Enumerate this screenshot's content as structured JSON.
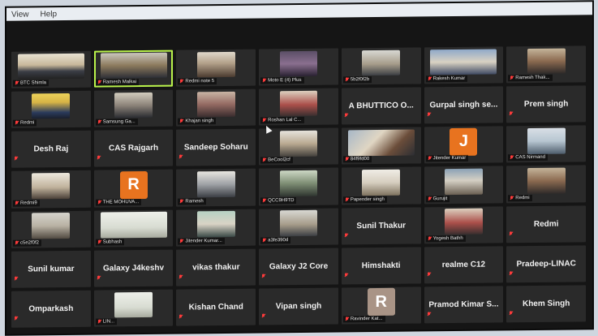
{
  "menubar": {
    "view": "View",
    "help": "Help"
  },
  "tiles": [
    {
      "type": "video",
      "label": "BTC Shimla",
      "scene": "sc1",
      "wide": true
    },
    {
      "type": "video",
      "label": "Ramesh Malkai",
      "scene": "sc2",
      "wide": true,
      "active": true
    },
    {
      "type": "video",
      "label": "Redmi note 5",
      "scene": "sc4"
    },
    {
      "type": "video",
      "label": "Moto E (4) Plus",
      "scene": "sc3"
    },
    {
      "type": "video",
      "label": "5b2f0f2b",
      "scene": "sc7"
    },
    {
      "type": "video",
      "label": "Rakesh Kumar",
      "scene": "sc5",
      "wide": true
    },
    {
      "type": "video",
      "label": "Ramesh Thak...",
      "scene": "sc8"
    },
    {
      "type": "video",
      "label": "Redmi",
      "scene": "sc6"
    },
    {
      "type": "video",
      "label": "Samsung Ga...",
      "scene": "sc10"
    },
    {
      "type": "video",
      "label": "Khajan singh",
      "scene": "sc9"
    },
    {
      "type": "video",
      "label": "Roshan Lal C...",
      "scene": "sc20"
    },
    {
      "type": "name",
      "name": "A BHUTTICO O..."
    },
    {
      "type": "name",
      "name": "Gurpal singh se..."
    },
    {
      "type": "name",
      "name": "Prem singh"
    },
    {
      "type": "name",
      "name": "Desh Raj"
    },
    {
      "type": "name",
      "name": "CAS Rajgarh"
    },
    {
      "type": "name",
      "name": "Sandeep Soharu"
    },
    {
      "type": "video",
      "label": "BeCool2cf",
      "scene": "sc12"
    },
    {
      "type": "video",
      "label": "84f9fd00",
      "scene": "sc11",
      "wide": true
    },
    {
      "type": "avatar",
      "letter": "J",
      "label": "Jitender Kumar",
      "color": "#e8731f"
    },
    {
      "type": "video",
      "label": "CAS Nirmand",
      "scene": "sc13"
    },
    {
      "type": "video",
      "label": "Redmi9",
      "scene": "sc16"
    },
    {
      "type": "avatar",
      "letter": "R",
      "label": "THE MOHUVA...",
      "color": "#e8731f"
    },
    {
      "type": "video",
      "label": "Ramesh",
      "scene": "sc15"
    },
    {
      "type": "video",
      "label": "QCC9H9TD",
      "scene": "sc14"
    },
    {
      "type": "video",
      "label": "Papender singh",
      "scene": "sc18"
    },
    {
      "type": "video",
      "label": "Gurujit",
      "scene": "sc17"
    },
    {
      "type": "video",
      "label": "Redmi",
      "scene": "sc8"
    },
    {
      "type": "video",
      "label": "c5e2f0f2",
      "scene": "sc21"
    },
    {
      "type": "video",
      "label": "Subhash",
      "scene": "sc22",
      "wide": true
    },
    {
      "type": "video",
      "label": "Jitender Kumar...",
      "scene": "sc19"
    },
    {
      "type": "video",
      "label": "a3fe390d",
      "scene": "sc7"
    },
    {
      "type": "name",
      "name": "Sunil Thakur"
    },
    {
      "type": "video",
      "label": "Yogesh Bathh",
      "scene": "sc20"
    },
    {
      "type": "name",
      "name": "Redmi"
    },
    {
      "type": "name",
      "name": "Sunil kumar"
    },
    {
      "type": "name",
      "name": "Galaxy J4keshv"
    },
    {
      "type": "name",
      "name": "vikas thakur"
    },
    {
      "type": "name",
      "name": "Galaxy J2 Core"
    },
    {
      "type": "name",
      "name": "Himshakti"
    },
    {
      "type": "name",
      "name": "realme C12"
    },
    {
      "type": "name",
      "name": "Pradeep-LINAC"
    },
    {
      "type": "name",
      "name": "Omparkash"
    },
    {
      "type": "video",
      "label": "LIN...",
      "scene": "sc22"
    },
    {
      "type": "name",
      "name": "Kishan Chand"
    },
    {
      "type": "name",
      "name": "Vipan singh"
    },
    {
      "type": "avatar",
      "letter": "R",
      "label": "Ravinder Kat...",
      "color": "#a99486"
    },
    {
      "type": "name",
      "name": "Pramod Kimar S..."
    },
    {
      "type": "name",
      "name": "Khem Singh"
    }
  ]
}
